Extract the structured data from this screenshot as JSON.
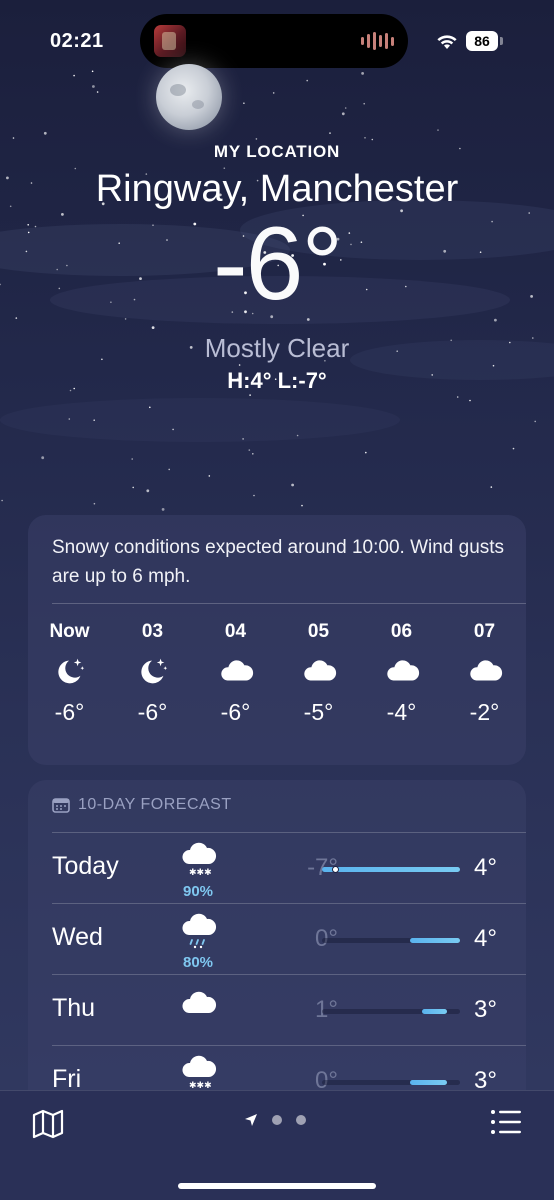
{
  "status": {
    "time": "02:21",
    "battery": "86"
  },
  "header": {
    "location_label": "MY LOCATION",
    "city": "Ringway, Manchester",
    "temperature": "-6°",
    "condition": "Mostly Clear",
    "high_low": "H:4°  L:-7°"
  },
  "hourly": {
    "summary": "Snowy conditions expected around 10:00. Wind gusts are up to 6 mph.",
    "items": [
      {
        "hour": "Now",
        "icon": "moon-stars-icon",
        "temp": "-6°"
      },
      {
        "hour": "03",
        "icon": "moon-stars-icon",
        "temp": "-6°"
      },
      {
        "hour": "04",
        "icon": "cloud-icon",
        "temp": "-6°"
      },
      {
        "hour": "05",
        "icon": "cloud-icon",
        "temp": "-5°"
      },
      {
        "hour": "06",
        "icon": "cloud-icon",
        "temp": "-4°"
      },
      {
        "hour": "07",
        "icon": "cloud-icon",
        "temp": "-2°"
      }
    ]
  },
  "daily": {
    "title": "10-DAY FORECAST",
    "range_min": -7,
    "range_max": 4,
    "items": [
      {
        "day": "Today",
        "icon": "cloud-snow-icon",
        "precip": "90%",
        "low": "-7°",
        "high": "4°",
        "low_val": -7,
        "high_val": 4,
        "current": -6
      },
      {
        "day": "Wed",
        "icon": "cloud-sleet-icon",
        "precip": "80%",
        "low": "0°",
        "high": "4°",
        "low_val": 0,
        "high_val": 4
      },
      {
        "day": "Thu",
        "icon": "cloud-icon",
        "precip": "",
        "low": "1°",
        "high": "3°",
        "low_val": 1,
        "high_val": 3
      },
      {
        "day": "Fri",
        "icon": "cloud-snow-icon",
        "precip": "",
        "low": "0°",
        "high": "3°",
        "low_val": 0,
        "high_val": 3
      }
    ]
  },
  "colors": {
    "accent_precip": "#7fc7f0",
    "bar_fill": "#5ab3ee"
  }
}
